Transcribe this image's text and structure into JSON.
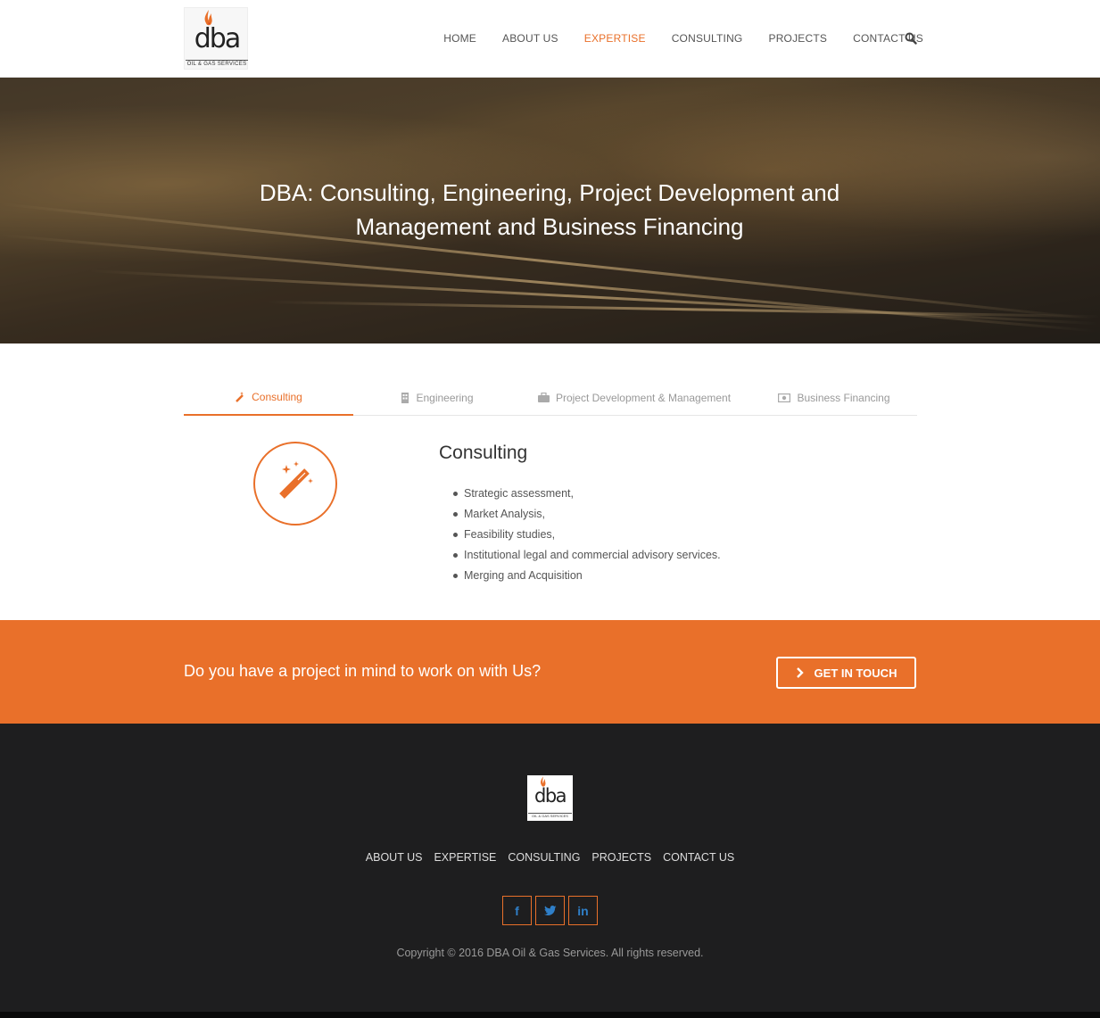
{
  "brand": {
    "logo_letters": "dba",
    "logo_tagline": "OIL & GAS SERVICES"
  },
  "nav": {
    "items": [
      {
        "label": "HOME",
        "active": false
      },
      {
        "label": "ABOUT US",
        "active": false
      },
      {
        "label": "EXPERTISE",
        "active": true
      },
      {
        "label": "CONSULTING",
        "active": false
      },
      {
        "label": "PROJECTS",
        "active": false
      },
      {
        "label": "CONTACT US",
        "active": false
      }
    ],
    "search_icon": "search-icon"
  },
  "hero": {
    "title_line1": "DBA: Consulting, Engineering, Project Development and",
    "title_line2": "Management and Business Financing"
  },
  "tabs": [
    {
      "label": "Consulting",
      "icon": "magic-wand-icon",
      "active": true
    },
    {
      "label": "Engineering",
      "icon": "building-icon",
      "active": false
    },
    {
      "label": "Project Development & Management",
      "icon": "briefcase-icon",
      "active": false
    },
    {
      "label": "Business Financing",
      "icon": "money-icon",
      "active": false
    }
  ],
  "content": {
    "title": "Consulting",
    "icon": "magic-wand-icon",
    "bullets": [
      "Strategic assessment,",
      "Market Analysis,",
      "Feasibility studies,",
      "Institutional legal and commercial advisory services.",
      "Merging and Acquisition"
    ]
  },
  "cta": {
    "text": "Do you have a project in mind to work on with Us?",
    "button_label": "GET IN TOUCH"
  },
  "footer": {
    "nav": [
      "ABOUT US",
      "EXPERTISE",
      "CONSULTING",
      "PROJECTS",
      "CONTACT US"
    ],
    "social": [
      {
        "name": "facebook-icon",
        "glyph": "f"
      },
      {
        "name": "twitter-icon",
        "glyph": "t"
      },
      {
        "name": "linkedin-icon",
        "glyph": "in"
      }
    ],
    "copyright": "Copyright © 2016 DBA Oil & Gas Services. All rights reserved."
  },
  "colors": {
    "accent": "#e9702a",
    "footer_bg": "#1e1e1f",
    "social_icon": "#2f7fc8"
  }
}
